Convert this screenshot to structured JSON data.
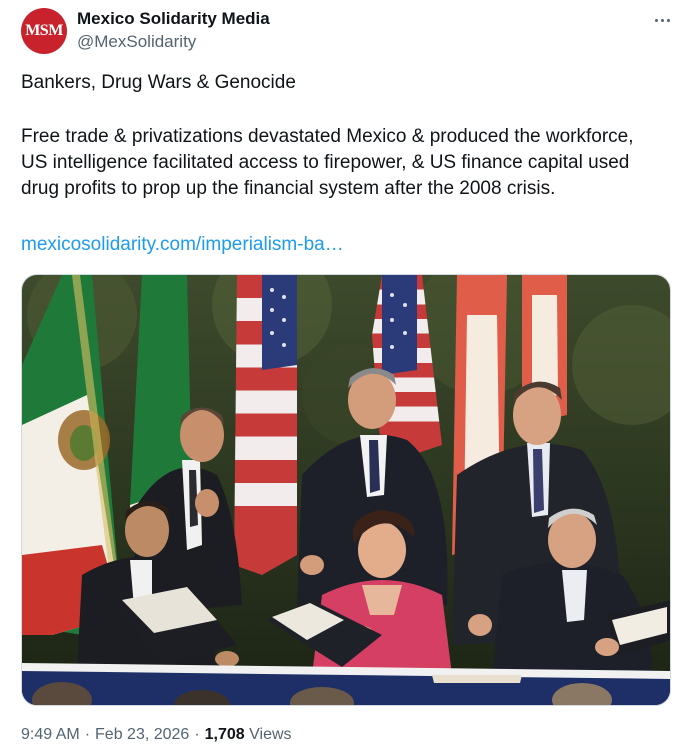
{
  "author": {
    "avatar_text": "MSM",
    "display_name": "Mexico Solidarity Media",
    "handle": "@MexSolidarity",
    "avatar_color": "#c8232c"
  },
  "tweet": {
    "title": "Bankers, Drug Wars & Genocide",
    "paragraph_lines": [
      "Free trade & privatizations devastated Mexico & produced the workforce,",
      "US intelligence facilitated access to firepower, & US finance capital used",
      "drug profits to prop up the financial system after the 2008 crisis."
    ],
    "link_text": "mexicosolidarity.com/imperialism-ba…"
  },
  "media": {
    "icon": "photo-image"
  },
  "meta": {
    "time": "9:49 AM",
    "date": "Feb 23, 2026",
    "views_count": "1,708",
    "views_label": "Views",
    "separator": "·"
  },
  "icons": {
    "more": "more-horizontal-icon"
  },
  "colors": {
    "link": "#1d9bf0",
    "secondary_text": "#536471",
    "primary_text": "#0f1419"
  }
}
